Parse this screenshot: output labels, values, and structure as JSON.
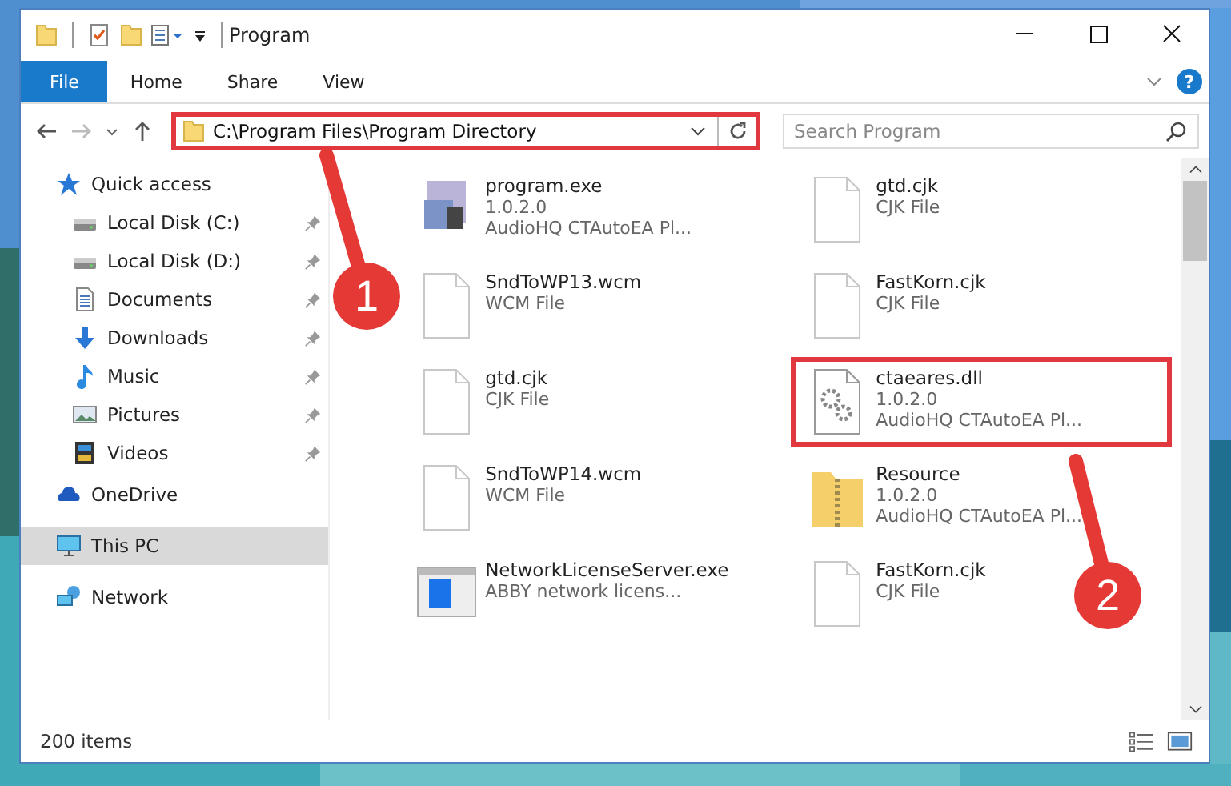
{
  "window": {
    "title": "Program"
  },
  "ribbon": {
    "tabs": [
      {
        "label": "File",
        "selected": true
      },
      {
        "label": "Home",
        "selected": false
      },
      {
        "label": "Share",
        "selected": false
      },
      {
        "label": "View",
        "selected": false
      }
    ],
    "help": "?"
  },
  "address": {
    "path": "C:\\Program Files\\Program Directory",
    "highlighted": true
  },
  "search": {
    "placeholder": "Search Program"
  },
  "sidebar": [
    {
      "label": "Quick access",
      "kind": "star",
      "selected": false,
      "children": [
        {
          "label": "Local Disk (C:)",
          "kind": "drive",
          "pinned": true
        },
        {
          "label": "Local Disk (D:)",
          "kind": "drive",
          "pinned": true
        },
        {
          "label": "Documents",
          "kind": "document",
          "pinned": true
        },
        {
          "label": "Downloads",
          "kind": "download",
          "pinned": true
        },
        {
          "label": "Music",
          "kind": "music",
          "pinned": true
        },
        {
          "label": "Pictures",
          "kind": "pictures",
          "pinned": true
        },
        {
          "label": "Videos",
          "kind": "videos",
          "pinned": true
        }
      ]
    },
    {
      "label": "OneDrive",
      "kind": "cloud",
      "selected": false
    },
    {
      "label": "This PC",
      "kind": "pc",
      "selected": true
    },
    {
      "label": "Network",
      "kind": "network",
      "selected": false
    }
  ],
  "files": [
    {
      "name": "program.exe",
      "lines": [
        "1.0.2.0",
        "AudioHQ CTAutoEA Pl..."
      ],
      "kind": "exe",
      "highlighted": false
    },
    {
      "name": "SndToWP13.wcm",
      "lines": [
        "WCM File"
      ],
      "kind": "blank",
      "highlighted": false
    },
    {
      "name": "gtd.cjk",
      "lines": [
        "CJK File"
      ],
      "kind": "blank",
      "highlighted": false
    },
    {
      "name": "SndToWP14.wcm",
      "lines": [
        "WCM File"
      ],
      "kind": "blank",
      "highlighted": false
    },
    {
      "name": "NetworkLicenseServer.exe",
      "lines": [
        "ABBY network licens..."
      ],
      "kind": "app",
      "highlighted": false
    },
    {
      "name": "gtd.cjk",
      "lines": [
        "CJK File"
      ],
      "kind": "blank",
      "highlighted": false
    },
    {
      "name": "FastKorn.cjk",
      "lines": [
        "CJK File"
      ],
      "kind": "blank",
      "highlighted": false
    },
    {
      "name": "ctaeares.dll",
      "lines": [
        "1.0.2.0",
        "AudioHQ CTAutoEA Pl..."
      ],
      "kind": "dll",
      "highlighted": true
    },
    {
      "name": "Resource",
      "lines": [
        "1.0.2.0",
        "AudioHQ CTAutoEA Pl..."
      ],
      "kind": "folder",
      "highlighted": false
    },
    {
      "name": "FastKorn.cjk",
      "lines": [
        "CJK File"
      ],
      "kind": "blank",
      "highlighted": false
    }
  ],
  "status_bar": {
    "count": "200 items"
  },
  "annotations": [
    {
      "number": "1"
    },
    {
      "number": "2"
    }
  ]
}
